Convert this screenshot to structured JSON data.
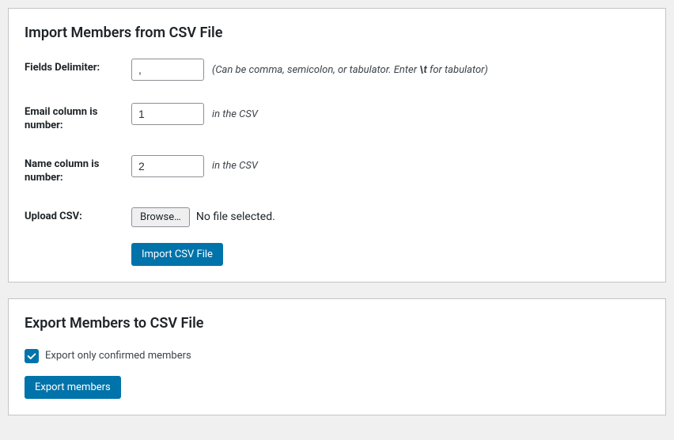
{
  "import": {
    "title": "Import Members from CSV File",
    "delimiter": {
      "label": "Fields Delimiter:",
      "value": ",",
      "hint_prefix": "(Can be comma, semicolon, or tabulator. Enter ",
      "hint_code": "\\t",
      "hint_suffix": " for tabulator)"
    },
    "email_col": {
      "label": "Email column is number:",
      "value": "1",
      "hint": "in the CSV"
    },
    "name_col": {
      "label": "Name column is number:",
      "value": "2",
      "hint": "in the CSV"
    },
    "upload": {
      "label": "Upload CSV:",
      "browse": "Browse…",
      "status": "No file selected."
    },
    "submit": "Import CSV File"
  },
  "export": {
    "title": "Export Members to CSV File",
    "confirmed_label": "Export only confirmed members",
    "submit": "Export members"
  }
}
